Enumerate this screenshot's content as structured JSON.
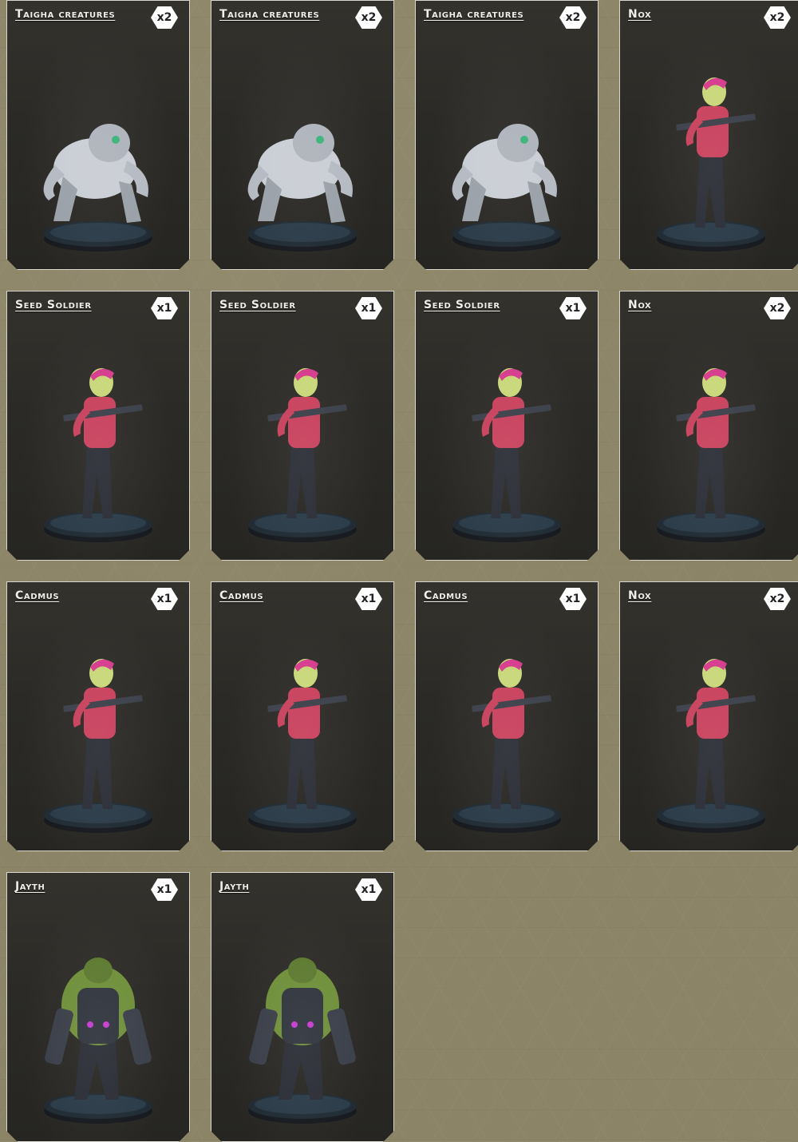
{
  "cards": [
    {
      "name": "Taigha creatures",
      "count": "x2",
      "figure": "creature"
    },
    {
      "name": "Taigha creatures",
      "count": "x2",
      "figure": "creature"
    },
    {
      "name": "Taigha creatures",
      "count": "x2",
      "figure": "creature"
    },
    {
      "name": "Nox",
      "count": "x2",
      "figure": "soldier"
    },
    {
      "name": "Seed Soldier",
      "count": "x1",
      "figure": "soldier"
    },
    {
      "name": "Seed Soldier",
      "count": "x1",
      "figure": "soldier"
    },
    {
      "name": "Seed Soldier",
      "count": "x1",
      "figure": "soldier"
    },
    {
      "name": "Nox",
      "count": "x2",
      "figure": "soldier"
    },
    {
      "name": "Cadmus",
      "count": "x1",
      "figure": "soldier"
    },
    {
      "name": "Cadmus",
      "count": "x1",
      "figure": "soldier"
    },
    {
      "name": "Cadmus",
      "count": "x1",
      "figure": "soldier"
    },
    {
      "name": "Nox",
      "count": "x2",
      "figure": "soldier"
    },
    {
      "name": "Jayth",
      "count": "x1",
      "figure": "brute"
    },
    {
      "name": "Jayth",
      "count": "x1",
      "figure": "brute"
    }
  ],
  "colors": {
    "background": "#8c8466",
    "card": "#2b2a26",
    "card_border": "#d8d6cf",
    "creature_skin": "#c9cdd4",
    "soldier_skin": "#c8405c",
    "soldier_armor": "#2a2d35",
    "brute_skin": "#6f8f3a",
    "base": "#1f2a33"
  }
}
